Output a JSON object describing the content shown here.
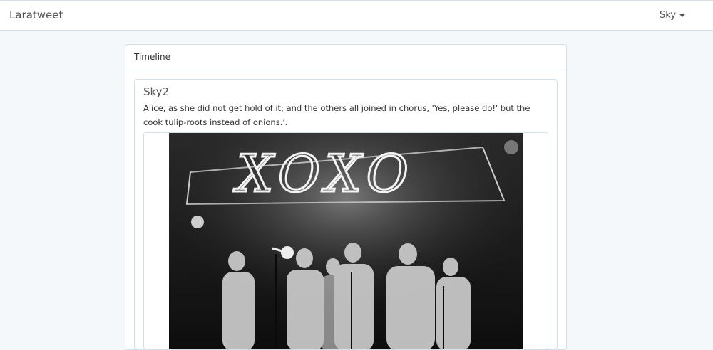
{
  "navbar": {
    "brand": "Laratweet",
    "user_name": "Sky"
  },
  "timeline": {
    "heading": "Timeline",
    "tweets": [
      {
        "author": "Sky2",
        "body": "Alice, as she did not get hold of it; and the others all joined in chorus, 'Yes, please do!' but the cook tulip-roots instead of onions.'.",
        "image": {
          "sign_text": "XOXO"
        }
      }
    ]
  }
}
